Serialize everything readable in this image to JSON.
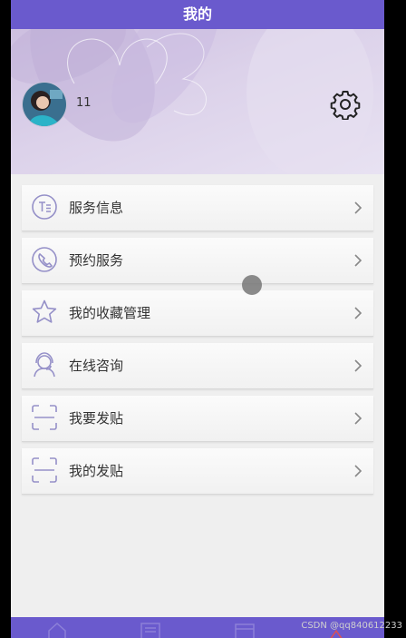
{
  "header": {
    "title": "我的"
  },
  "profile": {
    "username": "11"
  },
  "menu": {
    "items": [
      {
        "label": "服务信息",
        "icon": "document-icon"
      },
      {
        "label": "预约服务",
        "icon": "phone-icon"
      },
      {
        "label": "我的收藏管理",
        "icon": "star-icon"
      },
      {
        "label": "在线咨询",
        "icon": "support-agent-icon"
      },
      {
        "label": "我要发贴",
        "icon": "scan-frame-icon"
      },
      {
        "label": "我的发贴",
        "icon": "scan-frame-icon"
      }
    ]
  },
  "watermark": {
    "text": "CSDN @qq840612233"
  },
  "colors": {
    "brand": "#6a5acd",
    "icon": "#9590c8",
    "chevron": "#888888"
  }
}
